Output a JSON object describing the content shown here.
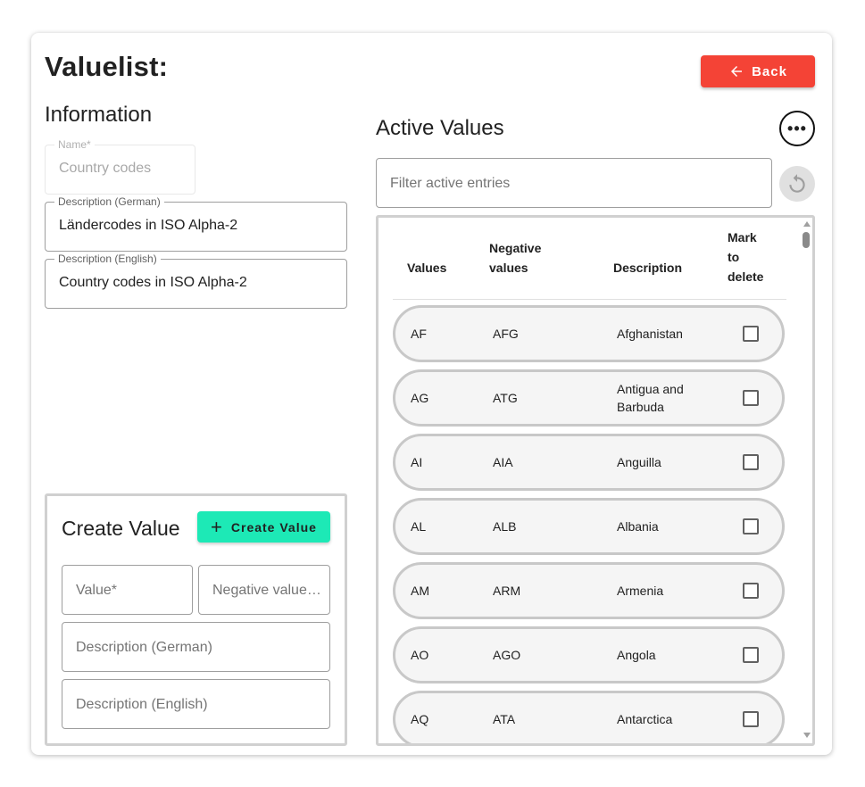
{
  "page_title": "Valuelist:",
  "back_button": "Back",
  "information": {
    "title": "Information",
    "name": {
      "label": "Name*",
      "value": "Country codes"
    },
    "description_german": {
      "label": "Description (German)",
      "value": "Ländercodes in ISO Alpha-2"
    },
    "description_english": {
      "label": "Description (English)",
      "value": "Country codes in ISO Alpha-2"
    }
  },
  "create_value": {
    "title": "Create Value",
    "button": "Create Value",
    "value_placeholder": "Value*",
    "negative_placeholder": "Negative value…",
    "desc_german_placeholder": "Description (German)",
    "desc_english_placeholder": "Description (English)"
  },
  "active_values": {
    "title": "Active Values",
    "filter_placeholder": "Filter active entries",
    "columns": {
      "values": "Values",
      "negative": [
        "Negative",
        "values"
      ],
      "description": "Description",
      "mark": [
        "Mark",
        "to",
        "delete"
      ]
    },
    "rows": [
      {
        "value": "AF",
        "negative": "AFG",
        "description": [
          "Afghanistan"
        ]
      },
      {
        "value": "AG",
        "negative": "ATG",
        "description": [
          "Antigua and",
          "Barbuda"
        ]
      },
      {
        "value": "AI",
        "negative": "AIA",
        "description": [
          "Anguilla"
        ]
      },
      {
        "value": "AL",
        "negative": "ALB",
        "description": [
          "Albania"
        ]
      },
      {
        "value": "AM",
        "negative": "ARM",
        "description": [
          "Armenia"
        ]
      },
      {
        "value": "AO",
        "negative": "AGO",
        "description": [
          "Angola"
        ]
      },
      {
        "value": "AQ",
        "negative": "ATA",
        "description": [
          "Antarctica"
        ]
      }
    ]
  },
  "colors": {
    "back_button": "#f44336",
    "create_button": "#1de9b6"
  }
}
